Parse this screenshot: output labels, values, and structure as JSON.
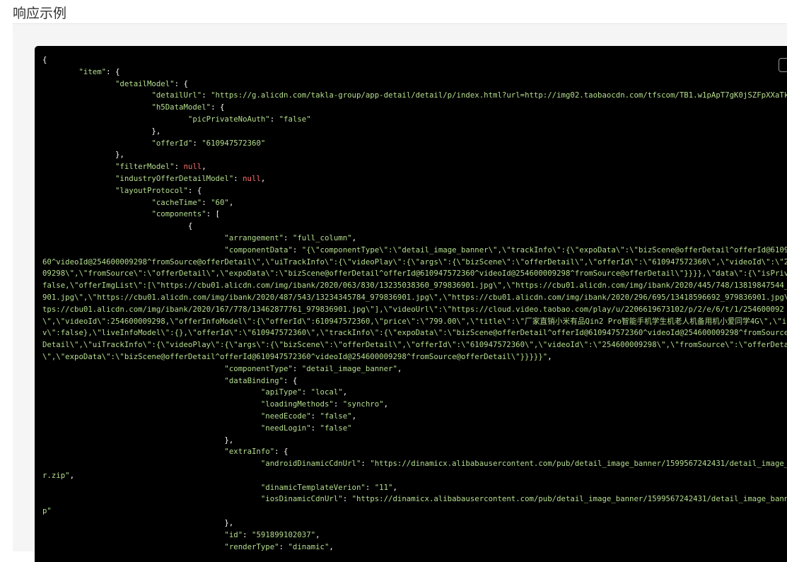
{
  "section": {
    "title": "响应示例"
  },
  "code_lines": [
    [
      [
        "p",
        "{"
      ]
    ],
    [
      [
        "p",
        "        "
      ],
      [
        "k",
        "\"item\""
      ],
      [
        "p",
        ": {"
      ]
    ],
    [
      [
        "p",
        "                "
      ],
      [
        "k",
        "\"detailModel\""
      ],
      [
        "p",
        ": {"
      ]
    ],
    [
      [
        "p",
        "                        "
      ],
      [
        "k",
        "\"detailUrl\""
      ],
      [
        "p",
        ": "
      ],
      [
        "s",
        "\"https://g.alicdn.com/takla-group/app-detail/detail/p/index.html?url=http://img02.taobaocdn.com/tfscom/TB1.w1pApT7gK0jSZFpXXaTkpXa.html\""
      ],
      [
        "p",
        ","
      ]
    ],
    [
      [
        "p",
        "                        "
      ],
      [
        "k",
        "\"h5DataModel\""
      ],
      [
        "p",
        ": {"
      ]
    ],
    [
      [
        "p",
        "                                "
      ],
      [
        "k",
        "\"picPrivateNoAuth\""
      ],
      [
        "p",
        ": "
      ],
      [
        "s",
        "\"false\""
      ]
    ],
    [
      [
        "p",
        "                        },"
      ]
    ],
    [
      [
        "p",
        "                        "
      ],
      [
        "k",
        "\"offerId\""
      ],
      [
        "p",
        ": "
      ],
      [
        "s",
        "\"610947572360\""
      ]
    ],
    [
      [
        "p",
        "                },"
      ]
    ],
    [
      [
        "p",
        "                "
      ],
      [
        "k",
        "\"filterModel\""
      ],
      [
        "p",
        ": "
      ],
      [
        "n",
        "null"
      ],
      [
        "p",
        ","
      ]
    ],
    [
      [
        "p",
        "                "
      ],
      [
        "k",
        "\"industryOfferDetailModel\""
      ],
      [
        "p",
        ": "
      ],
      [
        "n",
        "null"
      ],
      [
        "p",
        ","
      ]
    ],
    [
      [
        "p",
        "                "
      ],
      [
        "k",
        "\"layoutProtocol\""
      ],
      [
        "p",
        ": {"
      ]
    ],
    [
      [
        "p",
        "                        "
      ],
      [
        "k",
        "\"cacheTime\""
      ],
      [
        "p",
        ": "
      ],
      [
        "s",
        "\"60\""
      ],
      [
        "p",
        ","
      ]
    ],
    [
      [
        "p",
        "                        "
      ],
      [
        "k",
        "\"components\""
      ],
      [
        "p",
        ": ["
      ]
    ],
    [
      [
        "p",
        "                                {"
      ]
    ],
    [
      [
        "p",
        "                                        "
      ],
      [
        "k",
        "\"arrangement\""
      ],
      [
        "p",
        ": "
      ],
      [
        "s",
        "\"full_column\""
      ],
      [
        "p",
        ","
      ]
    ],
    [
      [
        "p",
        "                                        "
      ],
      [
        "k",
        "\"componentData\""
      ],
      [
        "p",
        ": "
      ],
      [
        "s",
        "\"{\\\"componentType\\\":\\\"detail_image_banner\\\",\\\"trackInfo\\\":{\\\"expoData\\\":\\\"bizScene@offerDetail^offerId@6109475723"
      ]
    ],
    [
      [
        "s",
        "60^videoId@254600009298^fromSource@offerDetail\\\",\\\"uiTrackInfo\\\":{\\\"videoPlay\\\":{\\\"args\\\":{\\\"bizScene\\\":\\\"offerDetail\\\",\\\"offerId\\\":\\\"610947572360\\\",\\\"videoId\\\":\\\"2546000"
      ]
    ],
    [
      [
        "s",
        "09298\\\",\\\"fromSource\\\":\\\"offerDetail\\\",\\\"expoData\\\":\\\"bizScene@offerDetail^offerId@610947572360^videoId@254600009298^fromSource@offerDetail\\\"}}}},\\\"data\\\":{\\\"isPrivate\\\":"
      ]
    ],
    [
      [
        "s",
        "false,\\\"offerImgList\\\":[\\\"https://cbu01.alicdn.com/img/ibank/2020/063/830/13235038360_979836901.jpg\\\",\\\"https://cbu01.alicdn.com/img/ibank/2020/445/748/13819847544_979836"
      ]
    ],
    [
      [
        "s",
        "901.jpg\\\",\\\"https://cbu01.alicdn.com/img/ibank/2020/487/543/13234345784_979836901.jpg\\\",\\\"https://cbu01.alicdn.com/img/ibank/2020/296/695/13418596692_979836901.jpg\\\",\\\"ht"
      ]
    ],
    [
      [
        "s",
        "tps://cbu01.alicdn.com/img/ibank/2020/167/778/13462877761_979836901.jpg\\\"],\\\"videoUrl\\\":\\\"https://cloud.video.taobao.com/play/u/2206619673102/p/2/e/6/t/1/254600092"
      ]
    ],
    [
      [
        "s",
        "\\\",\\\"videoId\\\":254600009298,\\\"offerInfoModel\\\":{\\\"offerId\\\":610947572360,\\\"price\\\":\\\"799.00\\\",\\\"title\\\":\\\"厂家直销小米有品Qin2 Pro智能手机学生机老人机备用机小爱同学4G\\\",\\\"isPri"
      ]
    ],
    [
      [
        "s",
        "v\\\":false},\\\"liveInfoModel\\\":{},\\\"offerId\\\":\\\"610947572360\\\",\\\"trackInfo\\\":{\\\"expoData\\\":\\\"bizScene@offerDetail^offerId@610947572360^videoId@254600009298^fromSource@offer"
      ]
    ],
    [
      [
        "s",
        "Detail\\\",\\\"uiTrackInfo\\\":{\\\"videoPlay\\\":{\\\"args\\\":{\\\"bizScene\\\":\\\"offerDetail\\\",\\\"offerId\\\":\\\"610947572360\\\",\\\"videoId\\\":\\\"254600009298\\\",\\\"fromSource\\\":\\\"offerDetail"
      ]
    ],
    [
      [
        "s",
        "\\\",\\\"expoData\\\":\\\"bizScene@offerDetail^offerId@610947572360^videoId@254600009298^fromSource@offerDetail\\\"}}}}}\""
      ],
      [
        "p",
        ","
      ]
    ],
    [
      [
        "p",
        "                                        "
      ],
      [
        "k",
        "\"componentType\""
      ],
      [
        "p",
        ": "
      ],
      [
        "s",
        "\"detail_image_banner\""
      ],
      [
        "p",
        ","
      ]
    ],
    [
      [
        "p",
        "                                        "
      ],
      [
        "k",
        "\"dataBinding\""
      ],
      [
        "p",
        ": {"
      ]
    ],
    [
      [
        "p",
        "                                                "
      ],
      [
        "k",
        "\"apiType\""
      ],
      [
        "p",
        ": "
      ],
      [
        "s",
        "\"local\""
      ],
      [
        "p",
        ","
      ]
    ],
    [
      [
        "p",
        "                                                "
      ],
      [
        "k",
        "\"loadingMethods\""
      ],
      [
        "p",
        ": "
      ],
      [
        "s",
        "\"synchro\""
      ],
      [
        "p",
        ","
      ]
    ],
    [
      [
        "p",
        "                                                "
      ],
      [
        "k",
        "\"needEcode\""
      ],
      [
        "p",
        ": "
      ],
      [
        "s",
        "\"false\""
      ],
      [
        "p",
        ","
      ]
    ],
    [
      [
        "p",
        "                                                "
      ],
      [
        "k",
        "\"needLogin\""
      ],
      [
        "p",
        ": "
      ],
      [
        "s",
        "\"false\""
      ]
    ],
    [
      [
        "p",
        "                                        },"
      ]
    ],
    [
      [
        "p",
        "                                        "
      ],
      [
        "k",
        "\"extraInfo\""
      ],
      [
        "p",
        ": {"
      ]
    ],
    [
      [
        "p",
        "                                                "
      ],
      [
        "k",
        "\"androidDinamicCdnUrl\""
      ],
      [
        "p",
        ": "
      ],
      [
        "s",
        "\"https://dinamicx.alibabausercontent.com/pub/detail_image_banner/1599567242431/detail_image_banne"
      ]
    ],
    [
      [
        "s",
        "r.zip\""
      ],
      [
        "p",
        ","
      ]
    ],
    [
      [
        "p",
        "                                                "
      ],
      [
        "k",
        "\"dinamicTemplateVerion\""
      ],
      [
        "p",
        ": "
      ],
      [
        "s",
        "\"11\""
      ],
      [
        "p",
        ","
      ]
    ],
    [
      [
        "p",
        "                                                "
      ],
      [
        "k",
        "\"iosDinamicCdnUrl\""
      ],
      [
        "p",
        ": "
      ],
      [
        "s",
        "\"https://dinamicx.alibabausercontent.com/pub/detail_image_banner/1599567242431/detail_image_banner.zi"
      ]
    ],
    [
      [
        "s",
        "p\""
      ]
    ],
    [
      [
        "p",
        "                                        },"
      ]
    ],
    [
      [
        "p",
        "                                        "
      ],
      [
        "k",
        "\"id\""
      ],
      [
        "p",
        ": "
      ],
      [
        "s",
        "\"591899102037\""
      ],
      [
        "p",
        ","
      ]
    ],
    [
      [
        "p",
        "                                        "
      ],
      [
        "k",
        "\"renderType\""
      ],
      [
        "p",
        ": "
      ],
      [
        "s",
        "\"dinamic\""
      ],
      [
        "p",
        ","
      ]
    ]
  ]
}
